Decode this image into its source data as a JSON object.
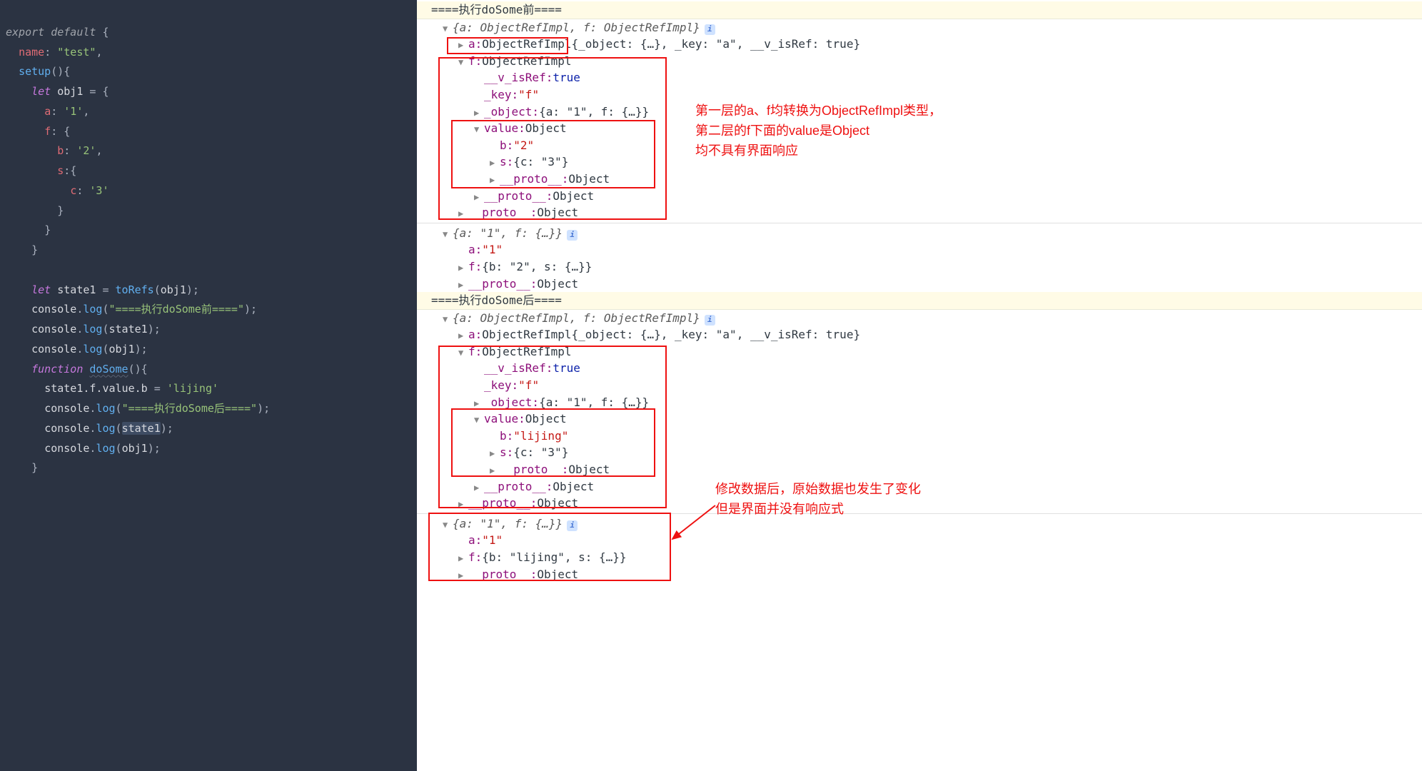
{
  "code": {
    "l1_export": "export",
    "l1_default": "default",
    "l2_name": "name",
    "l2_val": "\"test\"",
    "l3_setup": "setup",
    "l4_let": "let",
    "l4_obj1": "obj1",
    "l5_a": "a",
    "l5_av": "'1'",
    "l6_f": "f",
    "l7_b": "b",
    "l7_bv": "'2'",
    "l8_s": "s",
    "l9_c": "c",
    "l9_cv": "'3'",
    "l14_let": "let",
    "l14_state1": "state1",
    "l14_toRefs": "toRefs",
    "l14_obj1": "obj1",
    "l15_console": "console",
    "l15_log": "log",
    "l15_str": "\"====执行doSome前====\"",
    "l16_console": "console",
    "l16_log": "log",
    "l16_arg": "state1",
    "l17_console": "console",
    "l17_log": "log",
    "l17_arg": "obj1",
    "l18_fn": "function",
    "l18_doSome": "doSome",
    "l19_lhs": "state1.f.value.b",
    "l19_rhs": "'lijing'",
    "l20_console": "console",
    "l20_log": "log",
    "l20_str": "\"====执行doSome后====\"",
    "l21_console": "console",
    "l21_log": "log",
    "l21_arg": "state1",
    "l22_console": "console",
    "l22_log": "log",
    "l22_arg": "obj1"
  },
  "console": {
    "sec1_head": "====执行doSome前====",
    "sec2_head": "====执行doSome后====",
    "summary_ref": "{a: ObjectRefImpl, f: ObjectRefImpl}",
    "a_line_key": "a: ",
    "a_line_type": "ObjectRefImpl",
    "a_line_rest": " {_object: {…}, _key: \"a\", __v_isRef: true}",
    "f_line": "f: ObjectRefImpl",
    "v_isRef_k": "__v_isRef:",
    "v_isRef_v": "true",
    "key_k": "_key:",
    "key_v_f": "\"f\"",
    "object_k": "_object:",
    "object_v": "{a: \"1\", f: {…}}",
    "value_k": "value:",
    "value_t": "Object",
    "b_k": "b:",
    "b_v1": "\"2\"",
    "b_v2": "\"lijing\"",
    "s_k": "s:",
    "s_v": "{c: \"3\"}",
    "proto_k": "__proto__:",
    "proto_v": "Object",
    "plain_summary": "{a: \"1\", f: {…}}",
    "a_k": "a:",
    "a_v": "\"1\"",
    "f_k": "f:",
    "f_v1": "{b: \"2\", s: {…}}",
    "f_v2": "{b: \"lijing\", s: {…}}"
  },
  "annotations": {
    "top": "第一层的a、f均转换为ObjectRefImpl类型，\n第二层的f下面的value是Object\n均不具有界面响应",
    "bottom": "修改数据后，原始数据也发生了变化\n但是界面并没有响应式"
  },
  "info_glyph": "i"
}
